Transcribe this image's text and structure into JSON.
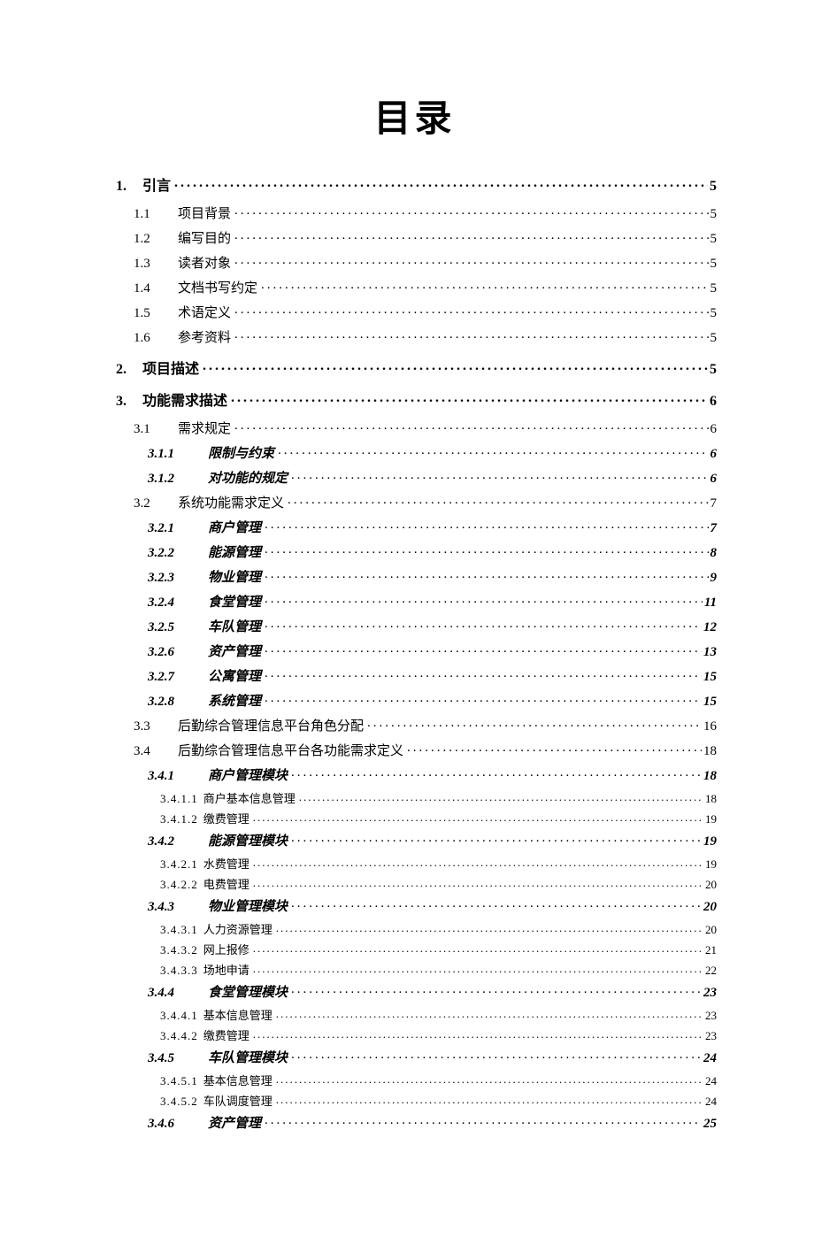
{
  "title": "目录",
  "entries": [
    {
      "level": 1,
      "num": "1.",
      "label": "引言",
      "page": "5"
    },
    {
      "level": 2,
      "num": "1.1",
      "label": "项目背景",
      "page": "5"
    },
    {
      "level": 2,
      "num": "1.2",
      "label": "编写目的",
      "page": "5"
    },
    {
      "level": 2,
      "num": "1.3",
      "label": "读者对象",
      "page": "5"
    },
    {
      "level": 2,
      "num": "1.4",
      "label": "文档书写约定",
      "page": "5"
    },
    {
      "level": 2,
      "num": "1.5",
      "label": "术语定义",
      "page": "5"
    },
    {
      "level": 2,
      "num": "1.6",
      "label": "参考资料",
      "page": "5"
    },
    {
      "level": 1,
      "num": "2.",
      "label": "项目描述",
      "page": "5"
    },
    {
      "level": 1,
      "num": "3.",
      "label": "功能需求描述",
      "page": "6"
    },
    {
      "level": 2,
      "num": "3.1",
      "label": "需求规定",
      "page": "6"
    },
    {
      "level": 3,
      "num": "3.1.1",
      "label": "限制与约束",
      "page": "6"
    },
    {
      "level": 3,
      "num": "3.1.2",
      "label": "对功能的规定",
      "page": "6"
    },
    {
      "level": 2,
      "num": "3.2",
      "label": "系统功能需求定义",
      "page": "7"
    },
    {
      "level": 3,
      "num": "3.2.1",
      "label": "商户管理",
      "page": "7"
    },
    {
      "level": 3,
      "num": "3.2.2",
      "label": "能源管理",
      "page": "8"
    },
    {
      "level": 3,
      "num": "3.2.3",
      "label": "物业管理",
      "page": "9"
    },
    {
      "level": 3,
      "num": "3.2.4",
      "label": "食堂管理",
      "page": "11"
    },
    {
      "level": 3,
      "num": "3.2.5",
      "label": "车队管理",
      "page": "12"
    },
    {
      "level": 3,
      "num": "3.2.6",
      "label": "资产管理",
      "page": "13"
    },
    {
      "level": 3,
      "num": "3.2.7",
      "label": "公寓管理",
      "page": "15"
    },
    {
      "level": 3,
      "num": "3.2.8",
      "label": "系统管理",
      "page": "15"
    },
    {
      "level": 2,
      "num": "3.3",
      "label": "后勤综合管理信息平台角色分配",
      "page": "16"
    },
    {
      "level": 2,
      "num": "3.4",
      "label": "后勤综合管理信息平台各功能需求定义",
      "page": "18"
    },
    {
      "level": 3,
      "num": "3.4.1",
      "label": "商户管理模块",
      "page": "18"
    },
    {
      "level": 4,
      "num": "3.4.1.1",
      "label": "商户基本信息管理",
      "page": "18"
    },
    {
      "level": 4,
      "num": "3.4.1.2",
      "label": "缴费管理",
      "page": "19"
    },
    {
      "level": 3,
      "num": "3.4.2",
      "label": "能源管理模块",
      "page": "19"
    },
    {
      "level": 4,
      "num": "3.4.2.1",
      "label": "水费管理",
      "page": "19"
    },
    {
      "level": 4,
      "num": "3.4.2.2",
      "label": "电费管理",
      "page": "20"
    },
    {
      "level": 3,
      "num": "3.4.3",
      "label": "物业管理模块",
      "page": "20"
    },
    {
      "level": 4,
      "num": "3.4.3.1",
      "label": "人力资源管理",
      "page": "20"
    },
    {
      "level": 4,
      "num": "3.4.3.2",
      "label": "网上报修",
      "page": "21"
    },
    {
      "level": 4,
      "num": "3.4.3.3",
      "label": "场地申请",
      "page": "22"
    },
    {
      "level": 3,
      "num": "3.4.4",
      "label": "食堂管理模块",
      "page": "23"
    },
    {
      "level": 4,
      "num": "3.4.4.1",
      "label": "基本信息管理",
      "page": "23"
    },
    {
      "level": 4,
      "num": "3.4.4.2",
      "label": "缴费管理",
      "page": "23"
    },
    {
      "level": 3,
      "num": "3.4.5",
      "label": "车队管理模块",
      "page": "24"
    },
    {
      "level": 4,
      "num": "3.4.5.1",
      "label": "基本信息管理",
      "page": "24"
    },
    {
      "level": 4,
      "num": "3.4.5.2",
      "label": "车队调度管理",
      "page": "24"
    },
    {
      "level": 3,
      "num": "3.4.6",
      "label": "资产管理",
      "page": "25"
    }
  ]
}
